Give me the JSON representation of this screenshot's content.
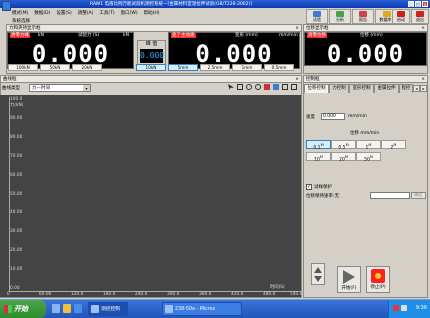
{
  "window": {
    "title": "RAW1 电液比例万能试验机测控系统—[金属材料室温拉伸试验(GB/T228-2002)]",
    "min": "_",
    "max": "□",
    "close": "×"
  },
  "menu": [
    "模式(M)",
    "数据(D)",
    "设置(S)",
    "调整(A)",
    "工具(T)",
    "窗口(W)",
    "帮助(H)"
  ],
  "subtitle": "系统选择",
  "toolbar": [
    {
      "label": "试验",
      "color": "#3d7bd3"
    },
    {
      "label": "分析",
      "color": "#47a34a"
    },
    {
      "label": "报告",
      "color": "#c44"
    },
    {
      "label": "数据库 ▾",
      "color": "#e0a81a"
    },
    {
      "label": "启动",
      "color": "#c22"
    },
    {
      "label": "退出",
      "color": "#c22"
    }
  ],
  "force_panel": {
    "title": "力和夹持显示框",
    "close": "×",
    "force": {
      "tag": "清零力峰",
      "unit": "kN",
      "value": "0.000"
    },
    "stress": {
      "label": "试验力 (S)",
      "unit": "kN",
      "value": "0.000"
    },
    "peak": {
      "label": "峰 值",
      "value": "0.000"
    },
    "speed": {
      "tag": "变了主动速",
      "unit": "mm/min",
      "value": "0.000"
    },
    "disp": {
      "label": "变形 (mm)",
      "unit": "",
      "value": "0.000"
    },
    "ranges_left": [
      "100kN",
      "50kN",
      "20kN",
      "10kN"
    ],
    "ranges_right": [
      "5mm",
      "2.5mm",
      "1mm",
      "0.5mm"
    ],
    "active_range": "10kN"
  },
  "position_panel": {
    "title": "位移显示框",
    "close": "×",
    "tag": "消零位移",
    "label": "位移 (mm)",
    "value": "0.000"
  },
  "curve_panel": {
    "title": "曲线框",
    "close": "×",
    "type_label": "曲线类型",
    "type_value": "力—时间"
  },
  "chart_data": {
    "type": "line",
    "series": [],
    "y_ticks": [
      "100.0",
      "90.00",
      "80.00",
      "70.00",
      "60.00",
      "50.00",
      "40.00",
      "30.00",
      "20.00",
      "10.00",
      "0.00"
    ],
    "x_ticks": [
      "0",
      "60.00",
      "120.0",
      "180.0",
      "240.0",
      "300.0",
      "360.0",
      "420.0",
      "480.0",
      "540.0"
    ],
    "ylabel": "力(kN)",
    "xlabel": "时间(S)",
    "xlim": [
      0,
      540
    ],
    "ylim": [
      0,
      100
    ],
    "grid": false,
    "background": "#444444"
  },
  "control_panel": {
    "title": "控制框",
    "close": "×",
    "tabs": [
      "位移控制",
      "力控制",
      "变形控制",
      "金属拉伸",
      "程控"
    ],
    "active_tab": "位移控制",
    "speed_label": "速度",
    "speed_value": "0.000",
    "speed_unit": "mm/min",
    "pos_label": "位移 mm/min",
    "presets_row1": [
      "0.1",
      "0.5",
      "1",
      "2"
    ],
    "presets_row2": [
      "10",
      "20",
      "50"
    ],
    "active_preset": "0.1",
    "checkbox_label": "试样保护",
    "checkbox_checked": true,
    "pos_protect_label": "位移保持速率:无",
    "apply_label": "确定",
    "start_label": "开始(F)",
    "stop_label": "停止(P)"
  },
  "taskbar": {
    "start": "开始",
    "tasks": [
      "测控控制",
      "238-50a - Micros"
    ],
    "clock": "9:36"
  }
}
